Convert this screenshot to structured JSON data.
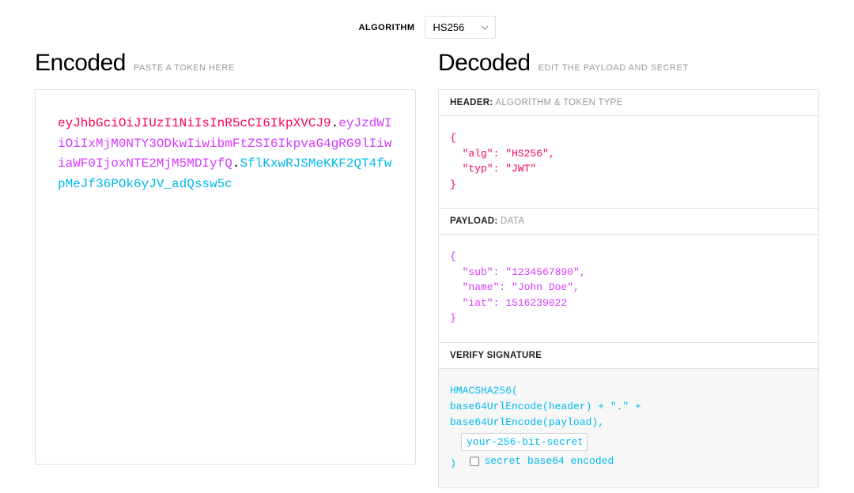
{
  "topbar": {
    "algorithm_label": "ALGORITHM",
    "algorithm_value": "HS256"
  },
  "encoded": {
    "title": "Encoded",
    "subtitle": "PASTE A TOKEN HERE",
    "token_header": "eyJhbGciOiJIUzI1NiIsInR5cCI6IkpXVCJ9",
    "token_payload": "eyJzdWIiOiIxMjM0NTY3ODkwIiwibmFtZSI6IkpvaG4gRG9lIiwiaWF0IjoxNTE2MjM5MDIyfQ",
    "token_signature": "SflKxwRJSMeKKF2QT4fwpMeJf36POk6yJV_adQssw5c"
  },
  "decoded": {
    "title": "Decoded",
    "subtitle": "EDIT THE PAYLOAD AND SECRET",
    "header_section": {
      "label_bold": "HEADER:",
      "label_muted": "ALGORITHM & TOKEN TYPE",
      "json_text": "{\n  \"alg\": \"HS256\",\n  \"typ\": \"JWT\"\n}"
    },
    "payload_section": {
      "label_bold": "PAYLOAD:",
      "label_muted": "DATA",
      "json_text": "{\n  \"sub\": \"1234567890\",\n  \"name\": \"John Doe\",\n  \"iat\": 1516239022\n}"
    },
    "signature_section": {
      "label_bold": "VERIFY SIGNATURE",
      "line1": "HMACSHA256(",
      "line2": "  base64UrlEncode(header) + \".\" +",
      "line3": "  base64UrlEncode(payload),",
      "secret_value": "your-256-bit-secret",
      "close_paren": ")",
      "checkbox_label": "secret base64 encoded"
    }
  }
}
